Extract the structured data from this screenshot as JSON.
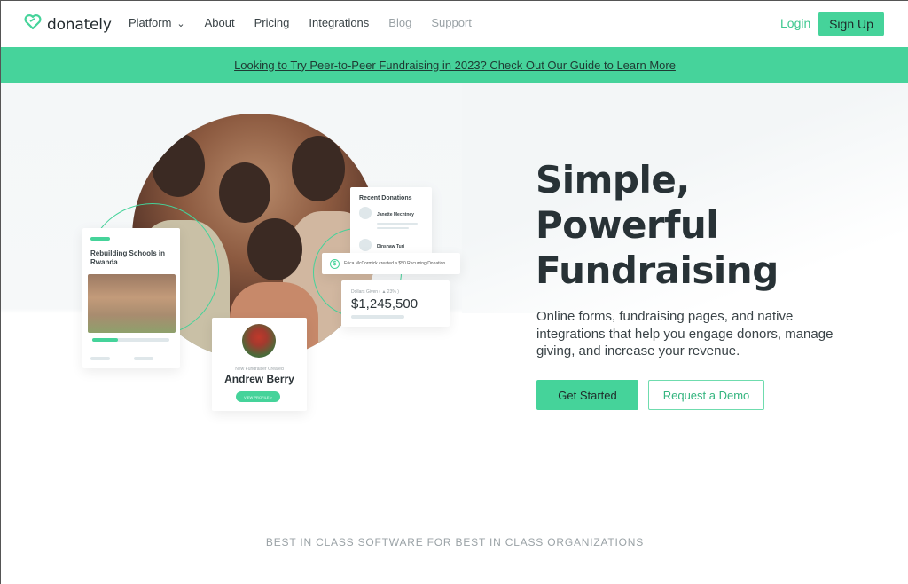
{
  "nav": {
    "logo_text": "donately",
    "links": [
      {
        "label": "Platform",
        "has_dropdown": true,
        "muted": false
      },
      {
        "label": "About",
        "muted": false
      },
      {
        "label": "Pricing",
        "muted": false
      },
      {
        "label": "Integrations",
        "muted": false
      },
      {
        "label": "Blog",
        "muted": true
      },
      {
        "label": "Support",
        "muted": true
      }
    ],
    "login_label": "Login",
    "signup_label": "Sign Up"
  },
  "banner": {
    "text": "Looking to Try Peer-to-Peer Fundraising in 2023? Check Out Our Guide to Learn More"
  },
  "hero": {
    "headline_lines": [
      "Simple,",
      "Powerful",
      "Fundraising"
    ],
    "subtext": "Online forms, fundraising pages, and native integrations that help you engage donors, manage giving, and increase your revenue.",
    "primary_cta": "Get Started",
    "secondary_cta": "Request a Demo"
  },
  "illustration": {
    "campaign_card": {
      "title": "Rebuilding Schools in Rwanda",
      "progress_fraction": 0.33
    },
    "donations_card": {
      "title": "Recent Donations",
      "donors": [
        "Janette Mechtney",
        "Dinshaw Turi"
      ]
    },
    "notification": {
      "text": "Erica McCormick created a $50 Recurring Donation"
    },
    "total_card": {
      "label": "Dollars Given ( ▲ 23% )",
      "value": "$1,245,500"
    },
    "fundraiser_card": {
      "label": "New Fundraiser Created",
      "name": "Andrew Berry",
      "button": "VIEW PROFILE >"
    }
  },
  "tagline": "BEST IN CLASS SOFTWARE FOR BEST IN CLASS ORGANIZATIONS",
  "colors": {
    "accent": "#45d39a",
    "text_dark": "#283236",
    "muted": "#9aa2a6"
  }
}
